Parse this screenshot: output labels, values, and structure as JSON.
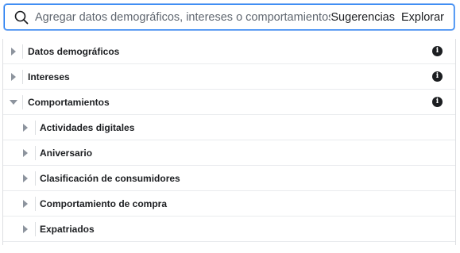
{
  "search": {
    "placeholder": "Agregar datos demográficos, intereses o comportamientos",
    "suggestions_label": "Sugerencias",
    "explore_label": "Explorar"
  },
  "categories": [
    {
      "label": "Datos demográficos",
      "expanded": false
    },
    {
      "label": "Intereses",
      "expanded": false
    },
    {
      "label": "Comportamientos",
      "expanded": true
    }
  ],
  "subcategories": [
    {
      "label": "Actividades digitales"
    },
    {
      "label": "Aniversario"
    },
    {
      "label": "Clasificación de consumidores"
    },
    {
      "label": "Comportamiento de compra"
    },
    {
      "label": "Expatriados"
    }
  ],
  "icons": {
    "search": "search-icon",
    "info": "info-icon",
    "collapsed": "caret-right-icon",
    "expanded": "caret-down-icon"
  },
  "colors": {
    "accent": "#1877f2",
    "arrow": "#8d949e",
    "text": "#1c1e21"
  }
}
